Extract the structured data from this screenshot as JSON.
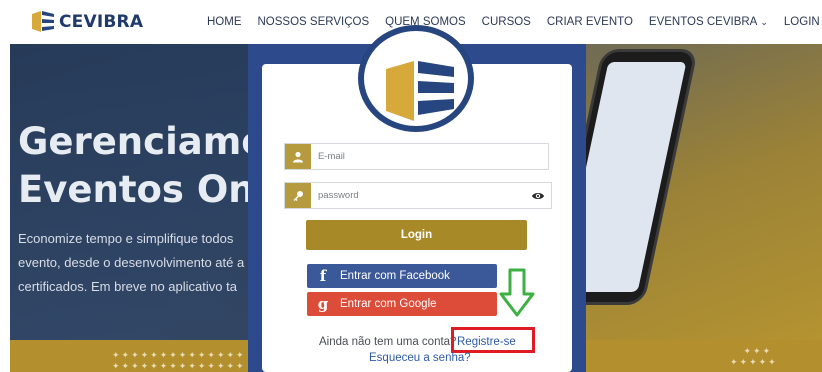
{
  "brand": {
    "name": "CEVIBRA"
  },
  "nav": {
    "items": [
      {
        "label": "HOME"
      },
      {
        "label": "NOSSOS SERVIÇOS"
      },
      {
        "label": "QUEM SOMOS"
      },
      {
        "label": "CURSOS"
      },
      {
        "label": "CRIAR EVENTO"
      },
      {
        "label": "EVENTOS CEVIBRA",
        "has_dropdown": true
      },
      {
        "label": "LOGIN"
      }
    ]
  },
  "hero": {
    "title_line1": "Gerenciamen",
    "title_line2": "Eventos Onli",
    "text_line1": "Economize tempo e simplifique todos",
    "text_line2": "evento, desde o desenvolvimento até a",
    "text_line3": "certificados. Em breve no aplicativo ta"
  },
  "login": {
    "email_placeholder": "E-mail",
    "password_placeholder": "password",
    "login_button": "Login",
    "facebook_button": "Entrar com Facebook",
    "google_button": "Entrar com Google",
    "signup_prompt": "Ainda não tem uma conta?",
    "signup_link": "Registre-se",
    "forgot_link": "Esqueceu a senha?"
  },
  "colors": {
    "accent_gold": "#a88928",
    "brand_navy": "#27467f",
    "facebook": "#3b5998",
    "google": "#dd4b39",
    "highlight_red": "#e01b24",
    "arrow_green": "#3cb043"
  },
  "icons": [
    "user-icon",
    "key-icon",
    "eye-icon",
    "facebook-icon",
    "google-icon",
    "arrow-down-icon",
    "chevron-down-icon"
  ]
}
